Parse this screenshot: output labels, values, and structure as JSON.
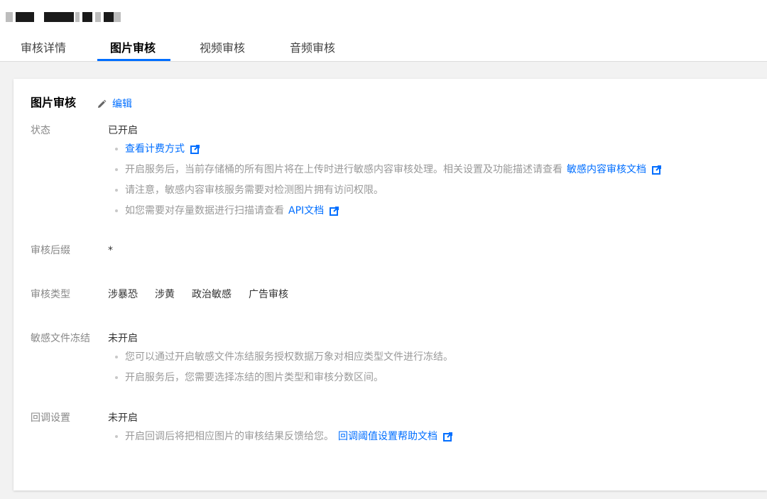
{
  "tabs": [
    {
      "label": "审核详情"
    },
    {
      "label": "图片审核",
      "active": true
    },
    {
      "label": "视频审核"
    },
    {
      "label": "音频审核"
    }
  ],
  "colors": {
    "accent": "#006eff",
    "hint": "#999999",
    "label": "#888888"
  },
  "card": {
    "title": "图片审核",
    "edit_label": "编辑",
    "status": {
      "label": "状态",
      "value": "已开启",
      "hints": {
        "billing_link": "查看计费方式",
        "service_text": "开启服务后，当前存储桶的所有图片将在上传时进行敏感内容审核处理。相关设置及功能描述请查看",
        "service_link": "敏感内容审核文档",
        "notice_text": "请注意，敏感内容审核服务需要对检测图片拥有访问权限。",
        "scan_text": "如您需要对存量数据进行扫描请查看",
        "scan_link": "API文档"
      }
    },
    "suffix": {
      "label": "审核后缀",
      "value": "*"
    },
    "types": {
      "label": "审核类型",
      "items": [
        "涉暴恐",
        "涉黄",
        "政治敏感",
        "广告审核"
      ]
    },
    "freeze": {
      "label": "敏感文件冻结",
      "value": "未开启",
      "hint1": "您可以通过开启敏感文件冻结服务授权数据万象对相应类型文件进行冻结。",
      "hint2": "开启服务后，您需要选择冻结的图片类型和审核分数区间。"
    },
    "callback": {
      "label": "回调设置",
      "value": "未开启",
      "hint_text": "开启回调后将把相应图片的审核结果反馈给您。",
      "hint_link": "回调阈值设置帮助文档"
    }
  }
}
